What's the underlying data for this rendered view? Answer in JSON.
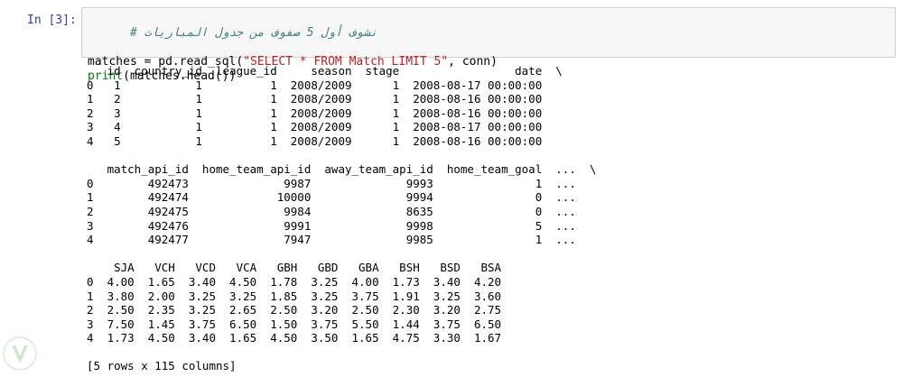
{
  "cell": {
    "prompt": "In [3]:",
    "comment": "# نشوف أول 5 صفوف من جدول المباريات",
    "line2_pre": "matches = pd.read_sql(",
    "line2_str": "\"SELECT * FROM Match LIMIT 5\"",
    "line2_post": ", conn)",
    "line3_kw": "print",
    "line3_rest": "(matches.head())"
  },
  "output": {
    "block1": [
      "   id  country_id  league_id     season  stage                 date  \\",
      "0   1           1          1  2008/2009      1  2008-08-17 00:00:00",
      "1   2           1          1  2008/2009      1  2008-08-16 00:00:00",
      "2   3           1          1  2008/2009      1  2008-08-16 00:00:00",
      "3   4           1          1  2008/2009      1  2008-08-17 00:00:00",
      "4   5           1          1  2008/2009      1  2008-08-16 00:00:00"
    ],
    "block2": [
      "   match_api_id  home_team_api_id  away_team_api_id  home_team_goal  ...  \\",
      "0        492473              9987              9993               1  ...",
      "1        492474             10000              9994               0  ...",
      "2        492475              9984              8635               0  ...",
      "3        492476              9991              9998               5  ...",
      "4        492477              7947              9985               1  ..."
    ],
    "block3": [
      "    SJA   VCH   VCD   VCA   GBH   GBD   GBA   BSH   BSD   BSA",
      "0  4.00  1.65  3.40  4.50  1.78  3.25  4.00  1.73  3.40  4.20",
      "1  3.80  2.00  3.25  3.25  1.85  3.25  3.75  1.91  3.25  3.60",
      "2  2.50  2.35  3.25  2.65  2.50  3.20  2.50  2.30  3.20  2.75",
      "3  7.50  1.45  3.75  6.50  1.50  3.75  5.50  1.44  3.75  6.50",
      "4  1.73  4.50  3.40  1.65  4.50  3.50  1.65  4.75  3.30  1.67"
    ],
    "summary": "[5 rows x 115 columns]"
  },
  "icons": {
    "logo": "shield-v-logo-icon"
  },
  "colors": {
    "prompt": "#303f9f",
    "string": "#ba2121",
    "keyword": "#008000",
    "comment": "#408080"
  }
}
